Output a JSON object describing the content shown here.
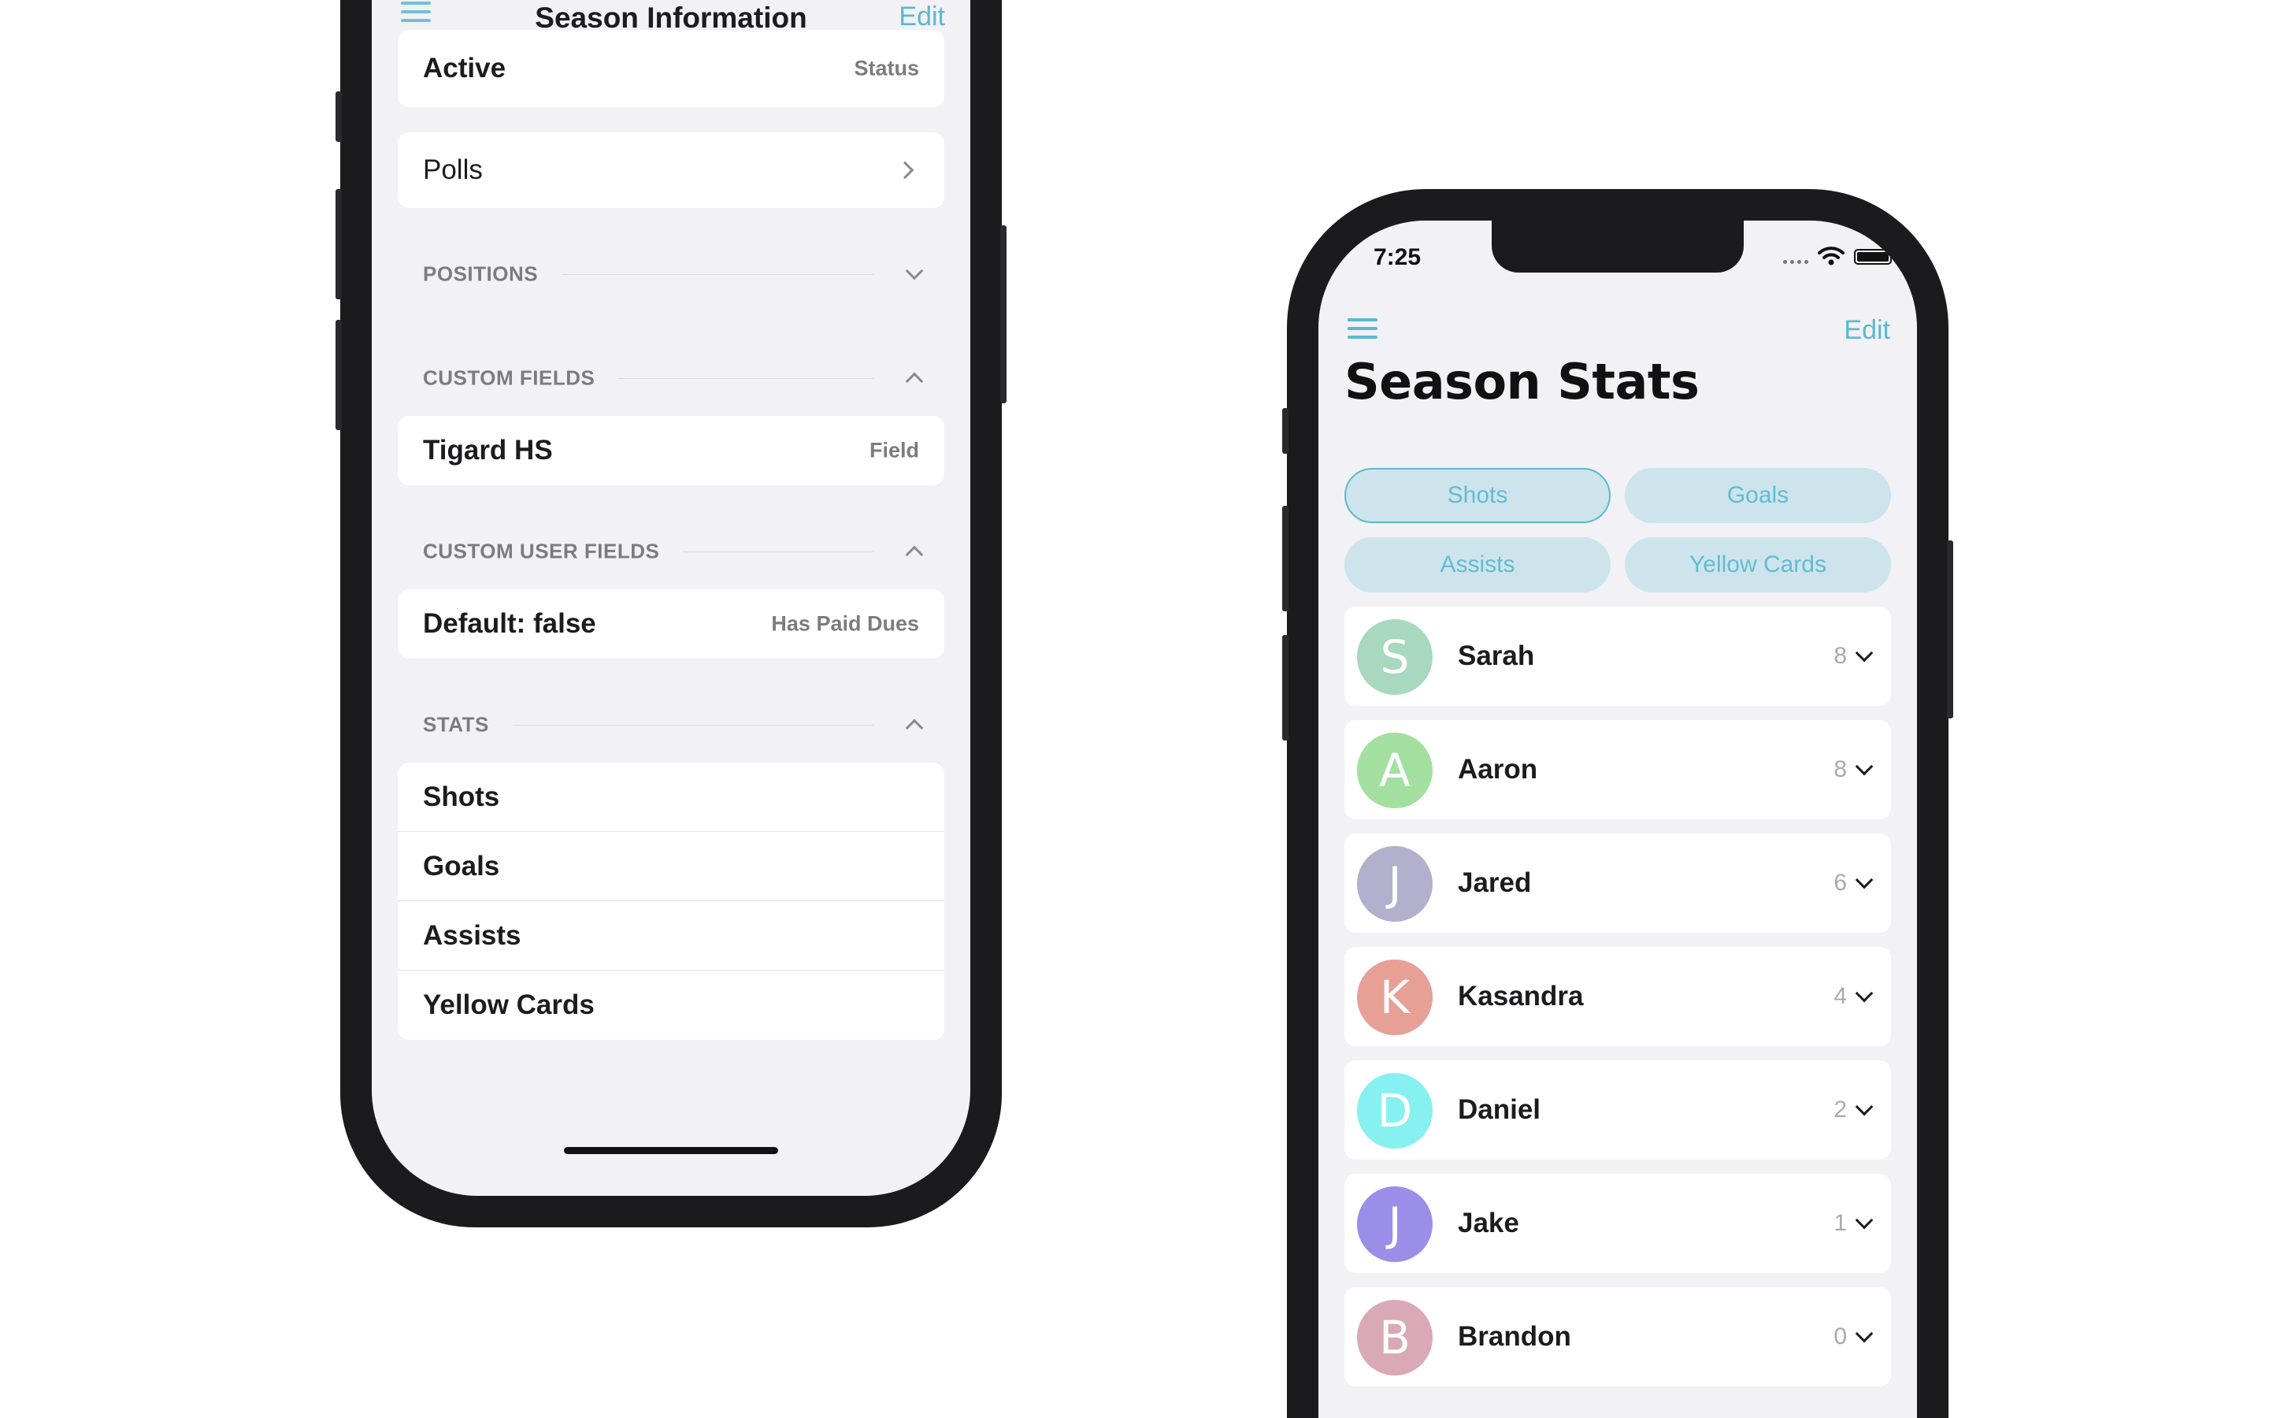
{
  "left_screen": {
    "nav": {
      "title": "Season Information",
      "edit_label": "Edit"
    },
    "status_row": {
      "value": "Active",
      "label": "Status"
    },
    "polls_row": {
      "label": "Polls"
    },
    "sections": {
      "positions": "POSITIONS",
      "custom_fields": "CUSTOM FIELDS",
      "custom_user_fields": "CUSTOM USER FIELDS",
      "stats": "STATS"
    },
    "field_row": {
      "value": "Tigard HS",
      "label": "Field"
    },
    "dues_row": {
      "value": "Default: false",
      "label": "Has Paid Dues"
    },
    "stats": [
      "Shots",
      "Goals",
      "Assists",
      "Yellow Cards"
    ]
  },
  "right_screen": {
    "status_bar": {
      "time": "7:25"
    },
    "nav": {
      "edit_label": "Edit"
    },
    "title": "Season Stats",
    "filters": [
      {
        "label": "Shots",
        "selected": true
      },
      {
        "label": "Goals",
        "selected": false
      },
      {
        "label": "Assists",
        "selected": false
      },
      {
        "label": "Yellow Cards",
        "selected": false
      }
    ],
    "players": [
      {
        "initial": "S",
        "name": "Sarah",
        "count": "8",
        "color": "#a8d8bd"
      },
      {
        "initial": "A",
        "name": "Aaron",
        "count": "8",
        "color": "#a3e0a0"
      },
      {
        "initial": "J",
        "name": "Jared",
        "count": "6",
        "color": "#b2b0cc"
      },
      {
        "initial": "K",
        "name": "Kasandra",
        "count": "4",
        "color": "#e7a096"
      },
      {
        "initial": "D",
        "name": "Daniel",
        "count": "2",
        "color": "#86f1f0"
      },
      {
        "initial": "J",
        "name": "Jake",
        "count": "1",
        "color": "#9a8ee9"
      },
      {
        "initial": "B",
        "name": "Brandon",
        "count": "0",
        "color": "#d9a9b8"
      }
    ]
  },
  "colors": {
    "accent": "#5bb8cf",
    "pill_bg": "#cde4ec",
    "screen_bg": "#f1f1f6"
  }
}
